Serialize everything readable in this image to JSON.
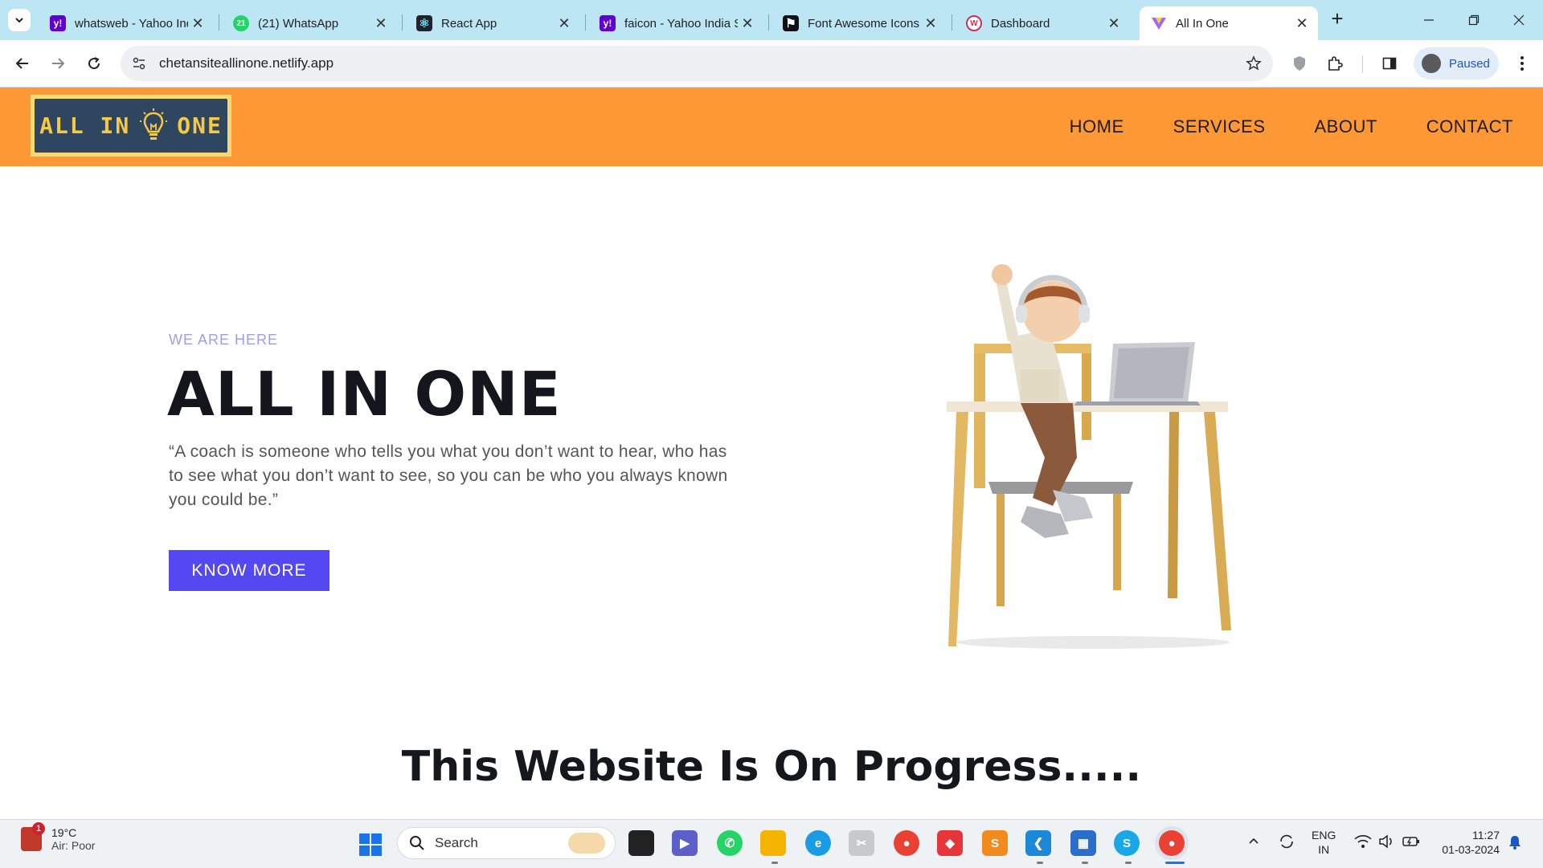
{
  "browser": {
    "tabs": [
      {
        "title": "whatsweb - Yahoo India Search Results",
        "icon": "yahoo-icon",
        "color": "#6001d2",
        "glyph": "y!"
      },
      {
        "title": "(21) WhatsApp",
        "icon": "whatsapp-icon",
        "color": "#25d366",
        "glyph": "21"
      },
      {
        "title": "React App",
        "icon": "react-icon",
        "color": "#20232a",
        "glyph": "⚛"
      },
      {
        "title": "faicon - Yahoo India Search Results",
        "icon": "yahoo-icon",
        "color": "#6001d2",
        "glyph": "y!"
      },
      {
        "title": "Font Awesome Icons",
        "icon": "flag-icon",
        "color": "#111111",
        "glyph": "⚑"
      },
      {
        "title": "Dashboard",
        "icon": "dashboard-icon",
        "color": "#d62d50",
        "glyph": "W"
      },
      {
        "title": "All In One",
        "icon": "vite-icon",
        "color": "#ffffff",
        "glyph": "▼",
        "active": true
      }
    ],
    "url": "chetansiteallinone.netlify.app",
    "profile_status": "Paused"
  },
  "site": {
    "logo": {
      "left": "ALL IN",
      "right": "ONE"
    },
    "nav": [
      "HOME",
      "SERVICES",
      "ABOUT",
      "CONTACT"
    ],
    "hero": {
      "eyebrow": "WE ARE HERE",
      "title": "ALL IN ONE",
      "quote": "“A coach is someone who tells you what you don’t want to hear, who has to see what you don’t want to see, so you can be who you always known you could be.”",
      "cta": "KNOW MORE"
    },
    "progress_heading": "This Website Is On Progress....."
  },
  "taskbar": {
    "weather": {
      "temp": "19°C",
      "status": "Air: Poor",
      "badge": "1"
    },
    "search_placeholder": "Search",
    "language": {
      "line1": "ENG",
      "line2": "IN"
    },
    "time": "11:27",
    "date": "01-03-2024"
  },
  "colors": {
    "header": "#fe9834",
    "accent": "#5448f2",
    "tabstrip": "#bde6f5"
  }
}
